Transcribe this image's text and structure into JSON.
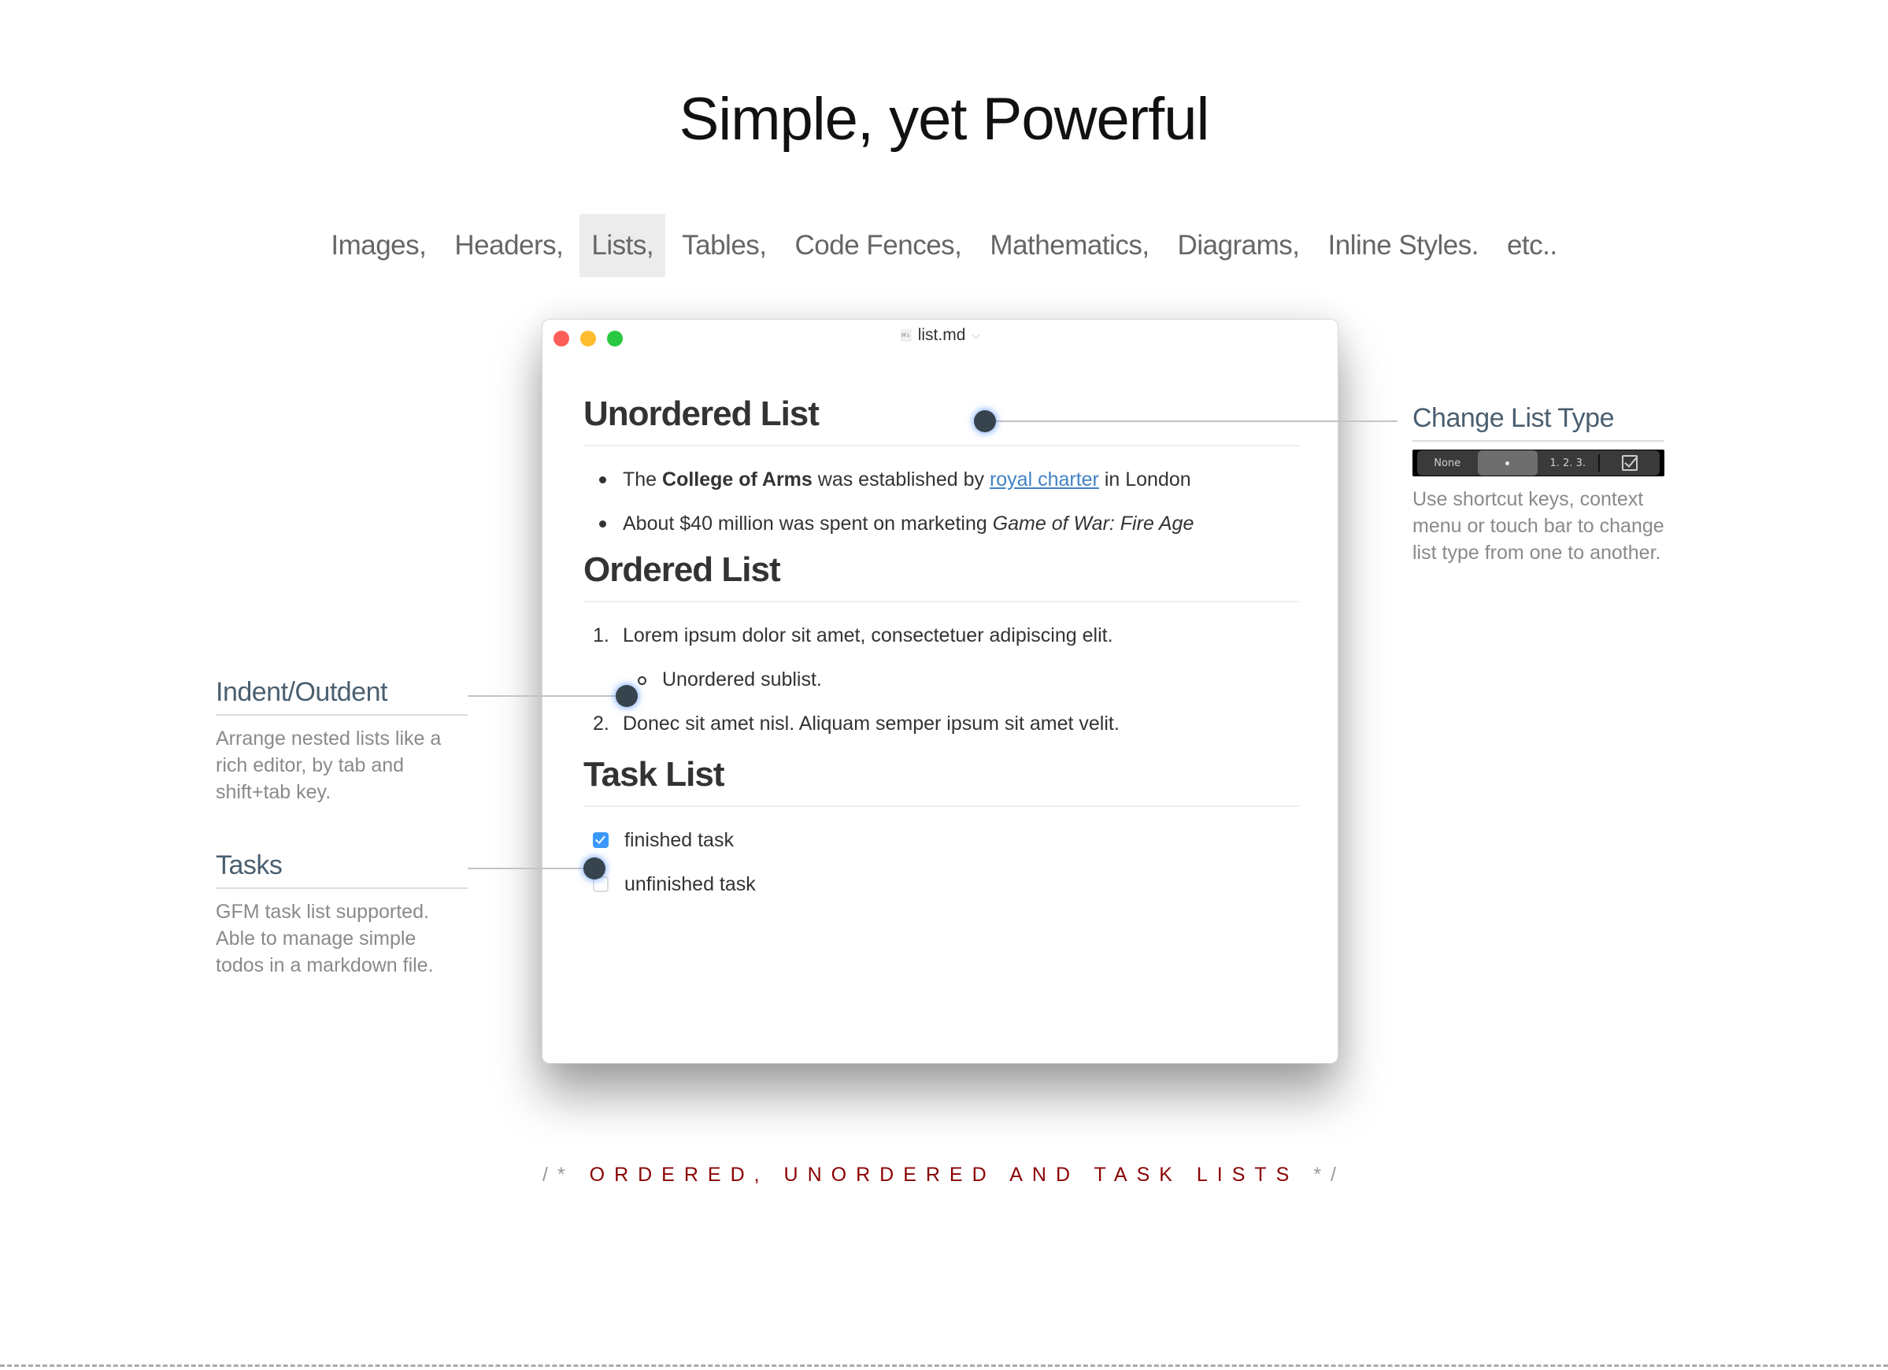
{
  "page": {
    "title": "Simple, yet Powerful"
  },
  "nav": {
    "items": [
      {
        "label": "Images,"
      },
      {
        "label": "Headers,"
      },
      {
        "label": "Lists,",
        "active": true
      },
      {
        "label": "Tables,"
      },
      {
        "label": "Code Fences,"
      },
      {
        "label": "Mathematics,"
      },
      {
        "label": "Diagrams,"
      },
      {
        "label": "Inline Styles."
      },
      {
        "label": "etc.."
      }
    ]
  },
  "window": {
    "filename": "list.md",
    "file_icon": "markdown-file-icon",
    "file_icon_text": "M↓"
  },
  "document": {
    "unordered": {
      "heading": "Unordered List",
      "item1": {
        "pre": "The ",
        "bold": "College of Arms",
        "mid": " was established by ",
        "link": "royal charter",
        "post": " in London"
      },
      "item2": {
        "pre": "About $40 million was spent on marketing ",
        "italic": "Game of War: Fire Age"
      }
    },
    "ordered": {
      "heading": "Ordered List",
      "item1": {
        "num": "1.",
        "text": "Lorem ipsum dolor sit amet, consectetuer adipiscing elit."
      },
      "sub1": {
        "text": "Unordered sublist."
      },
      "item2": {
        "num": "2.",
        "text": "Donec sit amet nisl. Aliquam semper ipsum sit amet velit."
      }
    },
    "tasks": {
      "heading": "Task List",
      "items": [
        {
          "text": "finished task",
          "checked": true
        },
        {
          "text": "unfinished task",
          "checked": false
        }
      ]
    }
  },
  "callouts": {
    "change_list_type": {
      "title": "Change List Type",
      "description": "Use shortcut keys, context menu or touch bar to change list type from one to another.",
      "touchbar": {
        "none_label": "None",
        "bullet_label": "•",
        "ordered_label": "1. 2. 3.",
        "selected": "bullet"
      }
    },
    "indent": {
      "title": "Indent/Outdent",
      "description": "Arrange nested lists like a rich editor, by tab and shift+tab key."
    },
    "tasks": {
      "title": "Tasks",
      "description": "GFM task list supported. Able to manage simple todos in a markdown file."
    }
  },
  "footer": {
    "comment_open": "/*",
    "caption": "ORDERED, UNORDERED AND TASK LISTS",
    "comment_close": "*/"
  },
  "colors": {
    "accent_caption": "#8b0000",
    "link": "#4183c4",
    "checkbox_checked": "#3b99fc",
    "callout_title": "#4a5f70"
  }
}
